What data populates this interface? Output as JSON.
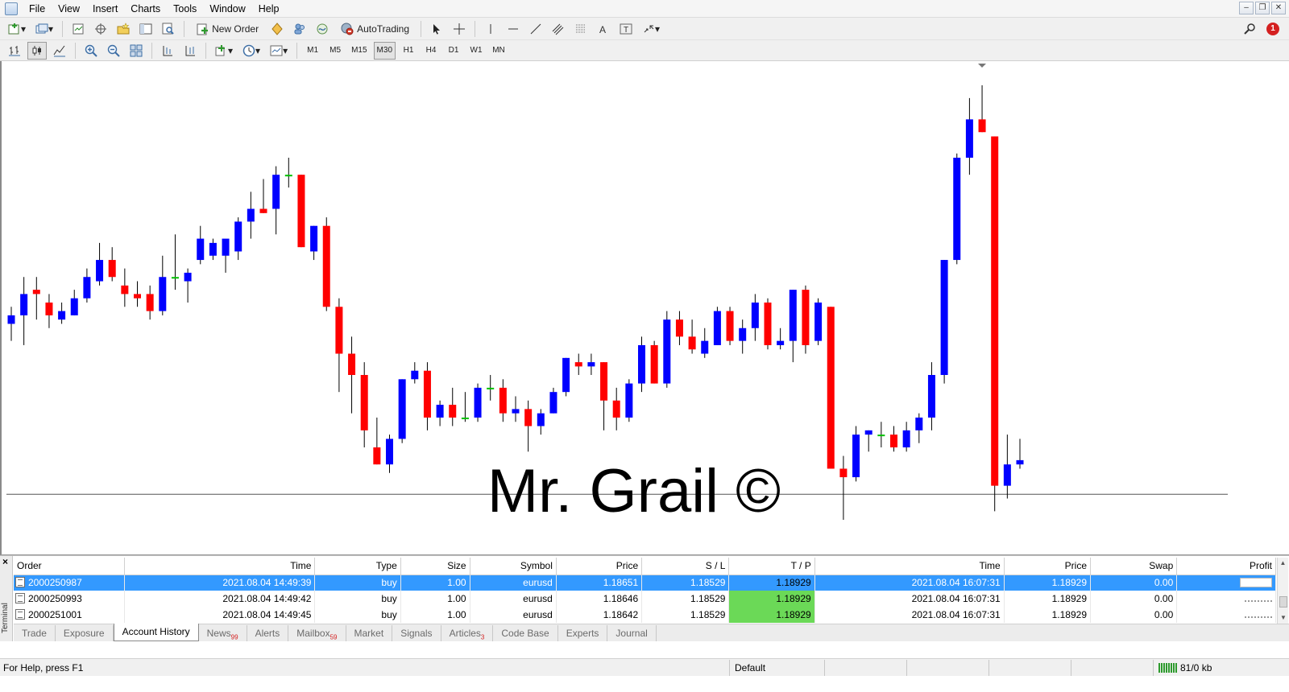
{
  "menu": [
    "File",
    "View",
    "Insert",
    "Charts",
    "Tools",
    "Window",
    "Help"
  ],
  "toolbar": {
    "new_order": "New Order",
    "autotrading": "AutoTrading",
    "notification_count": "1"
  },
  "timeframes": [
    "M1",
    "M5",
    "M15",
    "M30",
    "H1",
    "H4",
    "D1",
    "W1",
    "MN"
  ],
  "active_timeframe": "M30",
  "watermark": "Mr. Grail ©",
  "chart_data": {
    "type": "candlestick",
    "up_color": "#0000ff",
    "down_color": "#ff0000",
    "doji_color": "#00c000",
    "hline": 1.1852,
    "candles": [
      [
        1.1892,
        1.1896,
        1.1888,
        1.1894
      ],
      [
        1.1894,
        1.1903,
        1.1887,
        1.1899
      ],
      [
        1.19,
        1.1903,
        1.1893,
        1.1899
      ],
      [
        1.1897,
        1.1899,
        1.1891,
        1.1894
      ],
      [
        1.1893,
        1.1897,
        1.1892,
        1.1895
      ],
      [
        1.1894,
        1.19,
        1.1894,
        1.1898
      ],
      [
        1.1898,
        1.1905,
        1.1897,
        1.1903
      ],
      [
        1.1902,
        1.1911,
        1.1901,
        1.1907
      ],
      [
        1.1907,
        1.191,
        1.1902,
        1.1903
      ],
      [
        1.1901,
        1.1905,
        1.1896,
        1.1899
      ],
      [
        1.1899,
        1.1902,
        1.1896,
        1.1898
      ],
      [
        1.1899,
        1.1901,
        1.1893,
        1.1895
      ],
      [
        1.1895,
        1.1908,
        1.1894,
        1.1903
      ],
      [
        1.1903,
        1.1913,
        1.19,
        1.1903
      ],
      [
        1.1902,
        1.1905,
        1.1897,
        1.1904
      ],
      [
        1.1907,
        1.1915,
        1.1906,
        1.1912
      ],
      [
        1.1908,
        1.1912,
        1.1907,
        1.1911
      ],
      [
        1.1908,
        1.1911,
        1.1904,
        1.1912
      ],
      [
        1.1909,
        1.1917,
        1.1907,
        1.1916
      ],
      [
        1.1916,
        1.1923,
        1.1912,
        1.1919
      ],
      [
        1.1919,
        1.1926,
        1.1918,
        1.1918
      ],
      [
        1.1919,
        1.1929,
        1.1913,
        1.1927
      ],
      [
        1.1927,
        1.1931,
        1.1924,
        1.1927
      ],
      [
        1.1927,
        1.1927,
        1.191,
        1.191
      ],
      [
        1.1909,
        1.1915,
        1.1907,
        1.1915
      ],
      [
        1.1915,
        1.1917,
        1.1895,
        1.1896
      ],
      [
        1.1896,
        1.1898,
        1.1876,
        1.1885
      ],
      [
        1.1885,
        1.1889,
        1.1871,
        1.188
      ],
      [
        1.188,
        1.1883,
        1.1863,
        1.1867
      ],
      [
        1.1863,
        1.187,
        1.1859,
        1.1859
      ],
      [
        1.1859,
        1.1866,
        1.1857,
        1.1865
      ],
      [
        1.1865,
        1.1879,
        1.1864,
        1.1879
      ],
      [
        1.1879,
        1.1883,
        1.1878,
        1.1881
      ],
      [
        1.1881,
        1.1883,
        1.1867,
        1.187
      ],
      [
        1.187,
        1.1874,
        1.1868,
        1.1873
      ],
      [
        1.1873,
        1.1877,
        1.1868,
        1.187
      ],
      [
        1.187,
        1.1876,
        1.1869,
        1.187
      ],
      [
        1.187,
        1.1878,
        1.1869,
        1.1877
      ],
      [
        1.1877,
        1.188,
        1.1874,
        1.1877
      ],
      [
        1.1877,
        1.1879,
        1.1869,
        1.1871
      ],
      [
        1.1871,
        1.1875,
        1.1869,
        1.1872
      ],
      [
        1.1872,
        1.1874,
        1.1862,
        1.1868
      ],
      [
        1.1868,
        1.1872,
        1.1866,
        1.1871
      ],
      [
        1.1871,
        1.1877,
        1.1871,
        1.1876
      ],
      [
        1.1876,
        1.1884,
        1.1875,
        1.1884
      ],
      [
        1.1883,
        1.1885,
        1.188,
        1.1882
      ],
      [
        1.1882,
        1.1885,
        1.188,
        1.1883
      ],
      [
        1.1883,
        1.1883,
        1.1867,
        1.1874
      ],
      [
        1.1874,
        1.1877,
        1.1867,
        1.187
      ],
      [
        1.187,
        1.1879,
        1.1869,
        1.1878
      ],
      [
        1.1878,
        1.1889,
        1.1876,
        1.1887
      ],
      [
        1.1887,
        1.1888,
        1.1878,
        1.1878
      ],
      [
        1.1878,
        1.1895,
        1.1877,
        1.1893
      ],
      [
        1.1893,
        1.1895,
        1.1887,
        1.1889
      ],
      [
        1.1889,
        1.1893,
        1.1885,
        1.1886
      ],
      [
        1.1885,
        1.1891,
        1.1884,
        1.1888
      ],
      [
        1.1887,
        1.1896,
        1.1887,
        1.1895
      ],
      [
        1.1895,
        1.1896,
        1.1887,
        1.1888
      ],
      [
        1.1888,
        1.1893,
        1.1885,
        1.1891
      ],
      [
        1.1891,
        1.1899,
        1.1888,
        1.1897
      ],
      [
        1.1897,
        1.1898,
        1.1886,
        1.1887
      ],
      [
        1.1887,
        1.1891,
        1.1886,
        1.1888
      ],
      [
        1.1888,
        1.19,
        1.1883,
        1.19
      ],
      [
        1.19,
        1.1901,
        1.1885,
        1.1887
      ],
      [
        1.1888,
        1.1898,
        1.1887,
        1.1897
      ],
      [
        1.1896,
        1.1896,
        1.1859,
        1.1858
      ],
      [
        1.1858,
        1.1861,
        1.1846,
        1.1856
      ],
      [
        1.1856,
        1.1868,
        1.1855,
        1.1866
      ],
      [
        1.1866,
        1.1867,
        1.1862,
        1.1867
      ],
      [
        1.1866,
        1.1869,
        1.1863,
        1.1866
      ],
      [
        1.1866,
        1.1868,
        1.1862,
        1.1863
      ],
      [
        1.1863,
        1.1869,
        1.1862,
        1.1867
      ],
      [
        1.1867,
        1.1871,
        1.1864,
        1.187
      ],
      [
        1.187,
        1.1883,
        1.1867,
        1.188
      ],
      [
        1.188,
        1.1907,
        1.1878,
        1.1907
      ],
      [
        1.1907,
        1.1932,
        1.1906,
        1.1931
      ],
      [
        1.1931,
        1.1945,
        1.1927,
        1.194
      ],
      [
        1.194,
        1.1948,
        1.1937,
        1.1937
      ],
      [
        1.1936,
        1.1936,
        1.1848,
        1.1854
      ],
      [
        1.1854,
        1.1866,
        1.1851,
        1.1859
      ],
      [
        1.1859,
        1.1865,
        1.1858,
        1.186
      ]
    ]
  },
  "history": {
    "columns": [
      "Order",
      "Time",
      "Type",
      "Size",
      "Symbol",
      "Price",
      "S / L",
      "T / P",
      "Time",
      "Price",
      "Swap",
      "Profit"
    ],
    "rows": [
      {
        "order": "2000250987",
        "open_time": "2021.08.04 14:49:39",
        "type": "buy",
        "size": "1.00",
        "symbol": "eurusd",
        "price": "1.18651",
        "sl": "1.18529",
        "tp": "1.18929",
        "close_time": "2021.08.04 16:07:31",
        "close_price": "1.18929",
        "swap": "0.00",
        "profit": ""
      },
      {
        "order": "2000250993",
        "open_time": "2021.08.04 14:49:42",
        "type": "buy",
        "size": "1.00",
        "symbol": "eurusd",
        "price": "1.18646",
        "sl": "1.18529",
        "tp": "1.18929",
        "close_time": "2021.08.04 16:07:31",
        "close_price": "1.18929",
        "swap": "0.00",
        "profit": ""
      },
      {
        "order": "2000251001",
        "open_time": "2021.08.04 14:49:45",
        "type": "buy",
        "size": "1.00",
        "symbol": "eurusd",
        "price": "1.18642",
        "sl": "1.18529",
        "tp": "1.18929",
        "close_time": "2021.08.04 16:07:31",
        "close_price": "1.18929",
        "swap": "0.00",
        "profit": ""
      }
    ]
  },
  "terminal_label": "Terminal",
  "tabs": [
    {
      "label": "Trade",
      "count": ""
    },
    {
      "label": "Exposure",
      "count": ""
    },
    {
      "label": "Account History",
      "count": ""
    },
    {
      "label": "News",
      "count": "99"
    },
    {
      "label": "Alerts",
      "count": ""
    },
    {
      "label": "Mailbox",
      "count": "59"
    },
    {
      "label": "Market",
      "count": ""
    },
    {
      "label": "Signals",
      "count": ""
    },
    {
      "label": "Articles",
      "count": "3"
    },
    {
      "label": "Code Base",
      "count": ""
    },
    {
      "label": "Experts",
      "count": ""
    },
    {
      "label": "Journal",
      "count": ""
    }
  ],
  "active_tab": "Account History",
  "status": {
    "help": "For Help, press F1",
    "profile": "Default",
    "connection": "81/0 kb"
  }
}
